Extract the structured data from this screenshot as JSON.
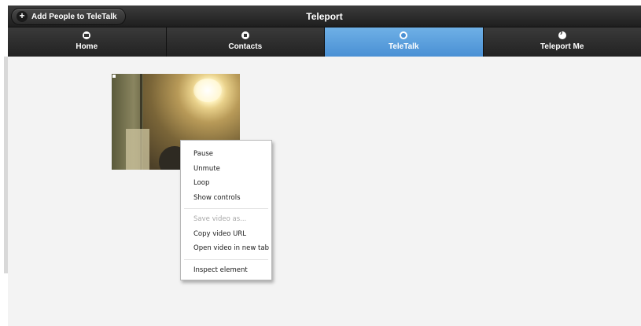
{
  "header": {
    "title": "Teleport",
    "add_button_label": "Add People to TeleTalk",
    "add_button_icon": "plus-icon"
  },
  "nav": {
    "tabs": [
      {
        "label": "Home",
        "icon": "home-icon",
        "active": false
      },
      {
        "label": "Contacts",
        "icon": "contacts-icon",
        "active": false
      },
      {
        "label": "TeleTalk",
        "icon": "chat-icon",
        "active": true
      },
      {
        "label": "Teleport Me",
        "icon": "arrow-right-icon",
        "active": false
      }
    ],
    "active_color": "#5aa0dc"
  },
  "context_menu": {
    "group1": [
      "Pause",
      "Unmute",
      "Loop",
      "Show controls"
    ],
    "group2": [
      "Save video as...",
      "Copy video URL",
      "Open video in new tab"
    ],
    "group3": [
      "Inspect element"
    ],
    "disabled_item": "Save video as..."
  }
}
